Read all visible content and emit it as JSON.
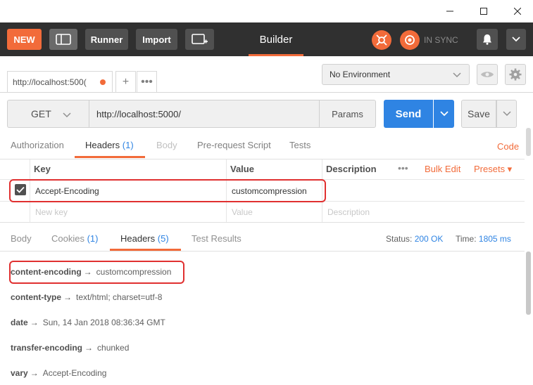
{
  "toolbar": {
    "new_label": "NEW",
    "runner_label": "Runner",
    "import_label": "Import",
    "builder_label": "Builder",
    "sync_label": "IN SYNC"
  },
  "tabs": {
    "request_tab_label": "http://localhost:500("
  },
  "environment": {
    "selected": "No Environment"
  },
  "request": {
    "method": "GET",
    "url": "http://localhost:5000/",
    "params_label": "Params",
    "send_label": "Send",
    "save_label": "Save"
  },
  "request_tabs": {
    "authorization": "Authorization",
    "headers": "Headers",
    "headers_count": "(1)",
    "body": "Body",
    "pre_request": "Pre-request Script",
    "tests": "Tests",
    "code": "Code"
  },
  "headers_table": {
    "columns": {
      "key": "Key",
      "value": "Value",
      "description": "Description"
    },
    "bulk_edit": "Bulk Edit",
    "presets": "Presets ▾",
    "rows": [
      {
        "key": "Accept-Encoding",
        "value": "customcompression",
        "description": "",
        "checked": true
      }
    ],
    "placeholders": {
      "key": "New key",
      "value": "Value",
      "description": "Description"
    }
  },
  "response_tabs": {
    "body": "Body",
    "cookies": "Cookies",
    "cookies_count": "(1)",
    "headers": "Headers",
    "headers_count": "(5)",
    "test_results": "Test Results"
  },
  "response_status": {
    "status_label": "Status:",
    "status_value": "200 OK",
    "time_label": "Time:",
    "time_value": "1805 ms"
  },
  "response_headers": [
    {
      "key": "content-encoding",
      "value": "customcompression"
    },
    {
      "key": "content-type",
      "value": "text/html; charset=utf-8"
    },
    {
      "key": "date",
      "value": "Sun, 14 Jan 2018 08:36:34 GMT"
    },
    {
      "key": "transfer-encoding",
      "value": "chunked"
    },
    {
      "key": "vary",
      "value": "Accept-Encoding"
    }
  ],
  "colors": {
    "accent": "#f26b3a",
    "primary": "#2f84e3",
    "highlight": "#e03030"
  }
}
